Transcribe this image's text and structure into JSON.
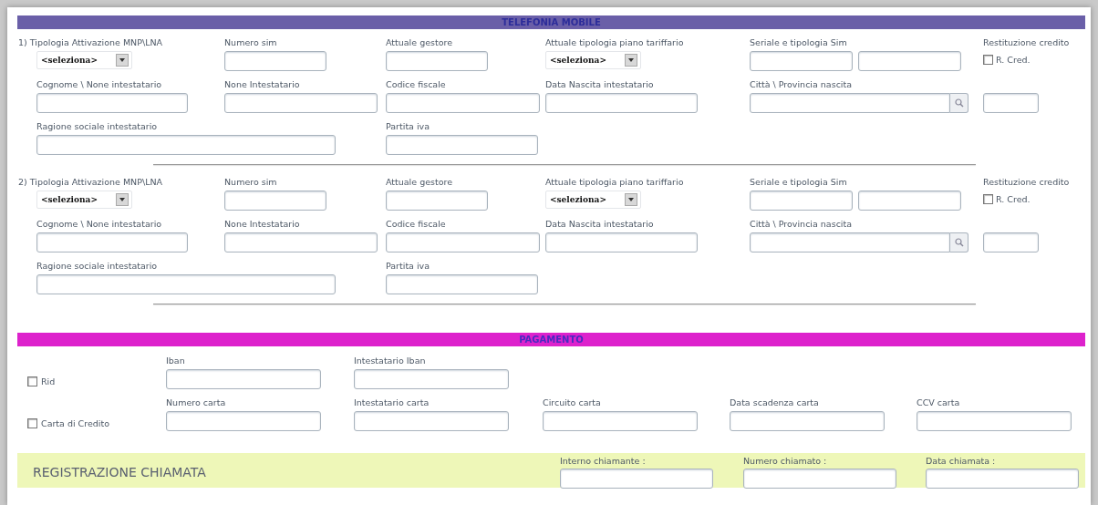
{
  "telefonia": {
    "title": "TELEFONIA MOBILE",
    "lines": [
      {
        "rows": [
          [
            {
              "kind": "select",
              "label": "1) Tipologia Attivazione MNP\\LNA",
              "value": "<seleziona>"
            },
            {
              "kind": "input",
              "label": "Numero sim"
            },
            {
              "kind": "input",
              "label": "Attuale gestore"
            },
            {
              "kind": "select",
              "label": "Attuale tipologia piano tariffario",
              "value": "<seleziona>"
            },
            {
              "kind": "pair",
              "label": "Seriale e tipologia Sim"
            },
            {
              "kind": "checkbox",
              "label": "Restituzione credito",
              "text": "R. Cred.",
              "checked": false
            }
          ],
          [
            {
              "kind": "input",
              "label": "Cognome \\ None intestatario"
            },
            {
              "kind": "input",
              "label": "None Intestatario"
            },
            {
              "kind": "input",
              "label": "Codice fiscale"
            },
            {
              "kind": "input",
              "label": "Data Nascita intestatario"
            },
            {
              "kind": "lookup",
              "label": "Città \\ Provincia nascita"
            },
            {
              "kind": "input"
            }
          ],
          [
            {
              "kind": "input",
              "label": "Ragione sociale intestatario"
            },
            "",
            {
              "kind": "input",
              "label": "Partita iva"
            }
          ]
        ]
      },
      {
        "rows": [
          [
            {
              "kind": "select",
              "label": "2) Tipologia Attivazione MNP\\LNA",
              "value": "<seleziona>"
            },
            {
              "kind": "input",
              "label": "Numero sim"
            },
            {
              "kind": "input",
              "label": "Attuale gestore"
            },
            {
              "kind": "select",
              "label": "Attuale tipologia piano tariffario",
              "value": "<seleziona>"
            },
            {
              "kind": "pair",
              "label": "Seriale e tipologia Sim"
            },
            {
              "kind": "checkbox",
              "label": "Restituzione credito",
              "text": "R. Cred.",
              "checked": false
            }
          ],
          [
            {
              "kind": "input",
              "label": "Cognome \\ None intestatario"
            },
            {
              "kind": "input",
              "label": "None Intestatario"
            },
            {
              "kind": "input",
              "label": "Codice fiscale"
            },
            {
              "kind": "input",
              "label": "Data Nascita intestatario"
            },
            {
              "kind": "lookup",
              "label": "Città \\ Provincia nascita"
            },
            {
              "kind": "input"
            }
          ],
          [
            {
              "kind": "input",
              "label": "Ragione sociale intestatario"
            },
            "",
            {
              "kind": "input",
              "label": "Partita iva"
            }
          ]
        ]
      }
    ]
  },
  "pagamento": {
    "title": "PAGAMENTO",
    "rows": [
      {
        "option": {
          "label": "Rid",
          "checked": false
        },
        "fields": [
          {
            "label": "Iban"
          },
          {
            "label": "Intestatario Iban"
          }
        ]
      },
      {
        "option": {
          "label": "Carta di Credito",
          "checked": false
        },
        "fields": [
          {
            "label": "Numero carta"
          },
          {
            "label": "Intestatario carta"
          },
          {
            "label": "Circuito carta"
          },
          {
            "label": "Data scadenza carta"
          },
          {
            "label": "CCV carta"
          }
        ]
      }
    ]
  },
  "registrazione": {
    "title": "REGISTRAZIONE CHIAMATA",
    "fields": [
      {
        "label": "Interno chiamante :"
      },
      {
        "label": "Numero chiamato :"
      },
      {
        "label": "Data chiamata :"
      }
    ]
  }
}
